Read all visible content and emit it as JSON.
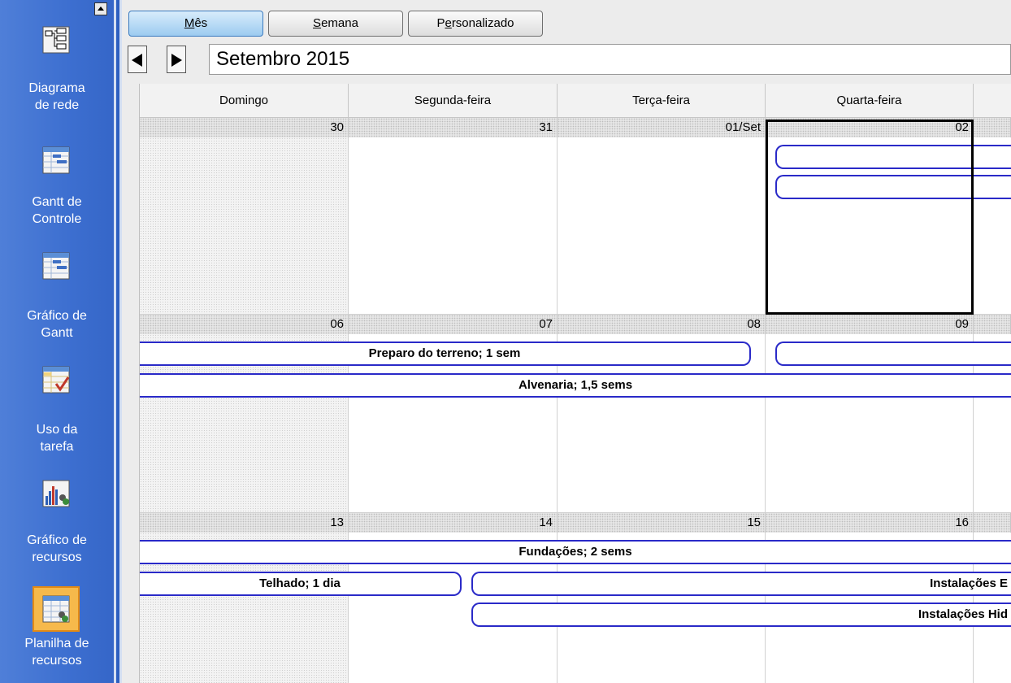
{
  "viewbar": {
    "items": [
      {
        "label1": "Diagrama",
        "label2": "de rede",
        "icon": "network-diagram-icon"
      },
      {
        "label1": "Gantt de",
        "label2": "Controle",
        "icon": "tracking-gantt-icon"
      },
      {
        "label1": "Gráfico de",
        "label2": "Gantt",
        "icon": "gantt-chart-icon"
      },
      {
        "label1": "Uso da",
        "label2": "tarefa",
        "icon": "task-usage-icon"
      },
      {
        "label1": "Gráfico de",
        "label2": "recursos",
        "icon": "resource-graph-icon"
      },
      {
        "label1": "Planilha de",
        "label2": "recursos",
        "icon": "resource-sheet-icon",
        "selected": true
      }
    ]
  },
  "tabs": {
    "month_pre": "",
    "month_u": "M",
    "month_post": "ês",
    "week_pre": "",
    "week_u": "S",
    "week_post": "emana",
    "custom_pre": "P",
    "custom_u": "e",
    "custom_post": "rsonalizado"
  },
  "month_title": "Setembro 2015",
  "day_headers": [
    "Domingo",
    "Segunda-feira",
    "Terça-feira",
    "Quarta-feira"
  ],
  "weeks": [
    {
      "dates": [
        "30",
        "31",
        "01/Set",
        "02"
      ]
    },
    {
      "dates": [
        "06",
        "07",
        "08",
        "09"
      ]
    },
    {
      "dates": [
        "13",
        "14",
        "15",
        "16"
      ]
    }
  ],
  "tasks": {
    "prep": "Preparo do terreno; 1 sem",
    "alvenaria": "Alvenaria; 1,5 sems",
    "fundacoes": "Fundações; 2 sems",
    "telhado": "Telhado; 1 dia",
    "inst_el": "Instalações E",
    "inst_hid": "Instalações Hid",
    "blank1": "",
    "blank2": "",
    "blank3": ""
  },
  "colors": {
    "viewbar": "#3d6fd0",
    "task_border": "#2a2ac8",
    "selected_view": "#f6b94b"
  }
}
